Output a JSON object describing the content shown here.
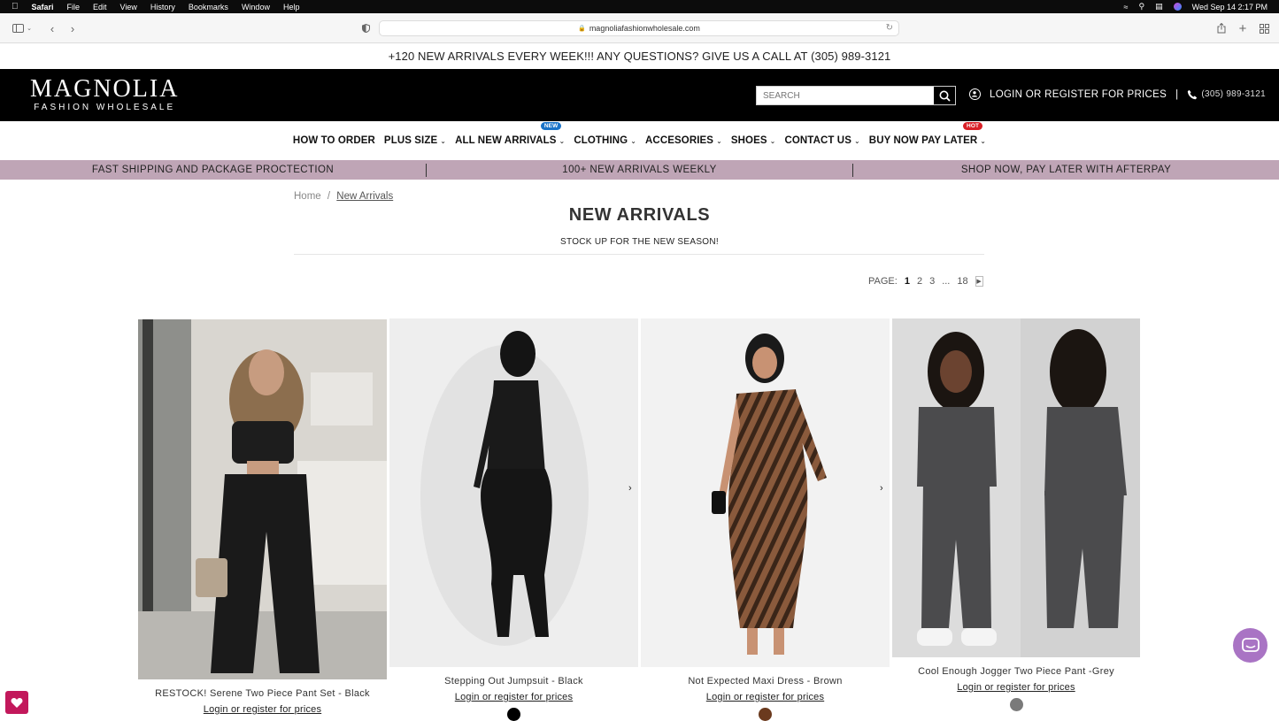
{
  "menubar": {
    "apple": "",
    "items": [
      "Safari",
      "File",
      "Edit",
      "View",
      "History",
      "Bookmarks",
      "Window",
      "Help"
    ],
    "datetime": "Wed Sep 14  2:17 PM"
  },
  "browser": {
    "url": "magnoliafashionwholesale.com"
  },
  "announcement": "+120 NEW ARRIVALS EVERY WEEK!!! ANY QUESTIONS? GIVE US A CALL AT (305) 989-3121",
  "header": {
    "logo_main": "MAGNOLIA",
    "logo_sub": "FASHION WHOLESALE",
    "search_placeholder": "SEARCH",
    "login_text": "LOGIN OR REGISTER FOR PRICES",
    "separator": "|",
    "phone": "(305) 989-3121"
  },
  "nav": [
    {
      "label": "HOW TO ORDER",
      "dropdown": false
    },
    {
      "label": "PLUS SIZE",
      "dropdown": true
    },
    {
      "label": "ALL NEW ARRIVALS",
      "dropdown": true,
      "badge": "NEW",
      "badge_color": "#1a73c8"
    },
    {
      "label": "CLOTHING",
      "dropdown": true
    },
    {
      "label": "ACCESORIES",
      "dropdown": true
    },
    {
      "label": "SHOES",
      "dropdown": true
    },
    {
      "label": "CONTACT US",
      "dropdown": true
    },
    {
      "label": "BUY NOW PAY LATER",
      "dropdown": true,
      "badge": "HOT",
      "badge_color": "#d92027"
    }
  ],
  "promo": [
    "FAST SHIPPING AND PACKAGE PROCTECTION",
    "100+ NEW ARRIVALS WEEKLY",
    "SHOP NOW, PAY LATER WITH AFTERPAY"
  ],
  "breadcrumb": {
    "home": "Home",
    "sep": "/",
    "current": "New Arrivals"
  },
  "page_title": "NEW ARRIVALS",
  "page_subtitle": "STOCK UP FOR THE NEW SEASON!",
  "pagination": {
    "label": "PAGE:",
    "pages": [
      "1",
      "2",
      "3",
      "...",
      "18"
    ],
    "current": "1"
  },
  "products": [
    {
      "name": "RESTOCK! Serene Two Piece Pant Set - Black",
      "price_link": "Login or register for prices",
      "swatch": null
    },
    {
      "name": "Stepping Out Jumpsuit - Black",
      "price_link": "Login or register for prices",
      "swatch": "#000000"
    },
    {
      "name": "Not Expected Maxi Dress - Brown",
      "price_link": "Login or register for prices",
      "swatch": "#6b3a1e"
    },
    {
      "name": "Cool Enough Jogger Two Piece Pant -Grey",
      "price_link": "Login or register for prices",
      "swatch": "#7a7a7a"
    }
  ],
  "colors": {
    "accent_promo": "#bfa5b6",
    "header_bg": "#000000",
    "wishlist": "#c2185b",
    "chat": "#a974c4"
  }
}
